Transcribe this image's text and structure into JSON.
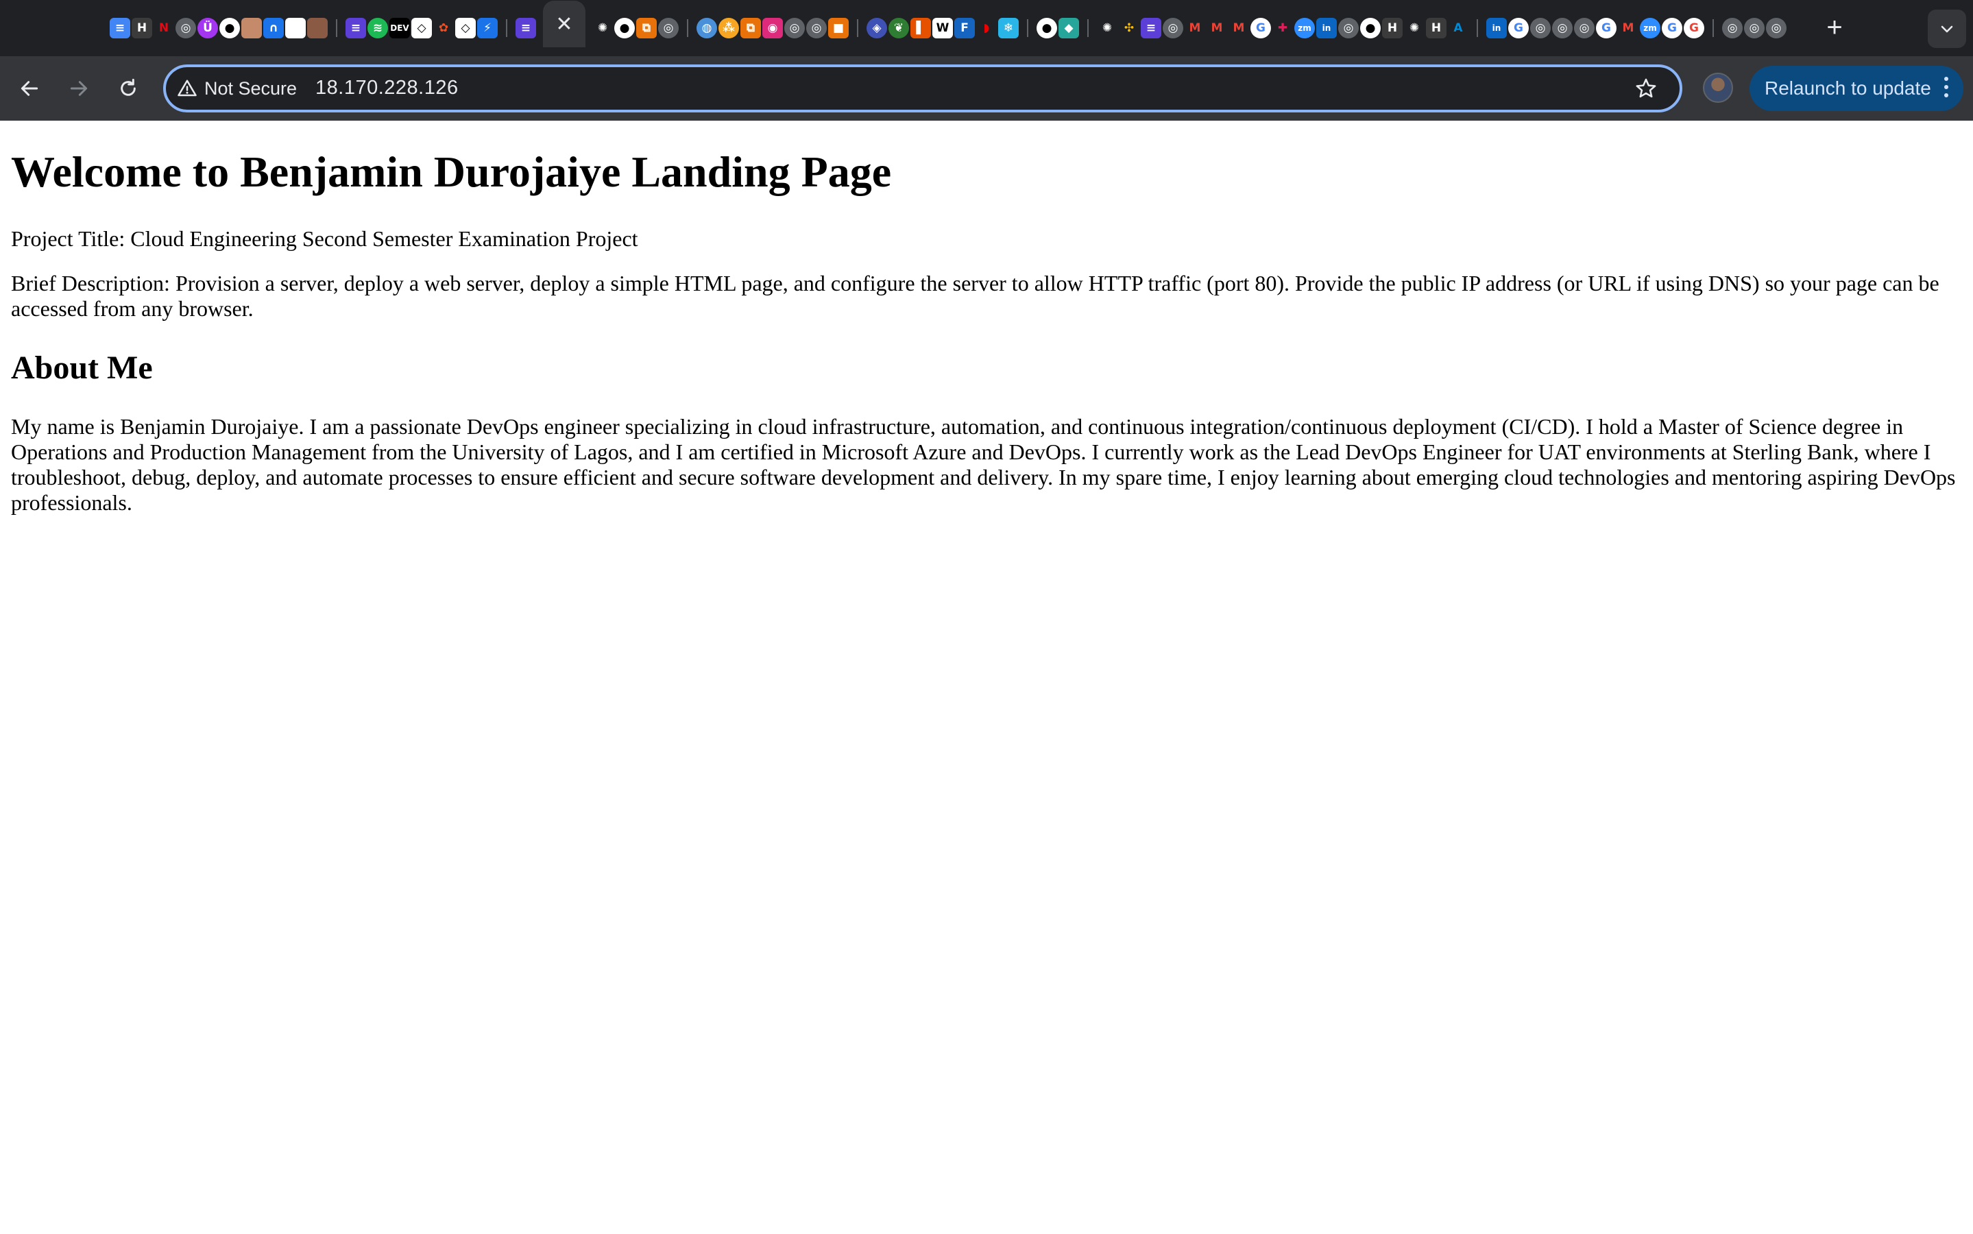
{
  "browser": {
    "tabs": {
      "active_close_glyph": "✕",
      "new_tab_glyph": "+",
      "favicons": [
        {
          "name": "google-docs-icon",
          "color": "#4285f4",
          "glyph": "≡"
        },
        {
          "name": "hashicorp-icon",
          "color": "#3b3b3b",
          "glyph": "H"
        },
        {
          "name": "netflix-icon",
          "color": "#202124",
          "glyph": "N",
          "fg": "#e50914"
        },
        {
          "name": "chatgpt-icon",
          "color": "#5f6368",
          "glyph": "◎",
          "round": true
        },
        {
          "name": "udemy-icon",
          "color": "#a435f0",
          "glyph": "Ü",
          "round": true
        },
        {
          "name": "github-icon",
          "color": "#ffffff",
          "glyph": "●",
          "fg": "#000",
          "round": true
        },
        {
          "name": "profile-photo-icon",
          "color": "#c58a6a",
          "glyph": ""
        },
        {
          "name": "ubiquiti-icon",
          "color": "#1a73e8",
          "glyph": "∩"
        },
        {
          "name": "blank-page-icon",
          "color": "#ffffff",
          "glyph": "",
          "fg": "#000"
        },
        {
          "name": "person-photo-icon",
          "color": "#8a5a44",
          "glyph": ""
        },
        {
          "sep": true
        },
        {
          "name": "tasks-icon",
          "color": "#5b3fd6",
          "glyph": "≡"
        },
        {
          "name": "spotify-icon",
          "color": "#1db954",
          "glyph": "≋",
          "round": true
        },
        {
          "name": "dev-to-icon",
          "color": "#000000",
          "glyph": "DEV"
        },
        {
          "name": "codepen-icon",
          "color": "#ffffff",
          "glyph": "◇",
          "fg": "#000"
        },
        {
          "name": "figma-icon",
          "color": "#202124",
          "glyph": "✿",
          "fg": "#f24e1e"
        },
        {
          "name": "codepen-alt-icon",
          "color": "#ffffff",
          "glyph": "◇",
          "fg": "#000"
        },
        {
          "name": "bolt-icon",
          "color": "#1a73e8",
          "glyph": "⚡"
        },
        {
          "sep": true
        },
        {
          "name": "tasks-alt-icon",
          "color": "#5b3fd6",
          "glyph": "≡"
        },
        {
          "active": true
        },
        {
          "name": "chatgpt-alt-icon",
          "color": "#202124",
          "glyph": "✺"
        },
        {
          "name": "github-alt-icon",
          "color": "#ffffff",
          "glyph": "●",
          "fg": "#000",
          "round": true
        },
        {
          "name": "copy-icon",
          "color": "#e8710a",
          "glyph": "⧉"
        },
        {
          "name": "globe-icon",
          "color": "#5f6368",
          "glyph": "◎",
          "round": true
        },
        {
          "sep": true
        },
        {
          "name": "world-icon",
          "color": "#4a90d9",
          "glyph": "◍",
          "round": true
        },
        {
          "name": "artifact-icon",
          "color": "#f6a623",
          "glyph": "⁂",
          "round": true
        },
        {
          "name": "copy-alt-icon",
          "color": "#e8710a",
          "glyph": "⧉"
        },
        {
          "name": "instagram-icon",
          "color": "#dd2a7b",
          "glyph": "◉"
        },
        {
          "name": "globe-alt-icon",
          "color": "#5f6368",
          "glyph": "◎",
          "round": true
        },
        {
          "name": "globe-third-icon",
          "color": "#5f6368",
          "glyph": "◎",
          "round": true
        },
        {
          "name": "box-icon",
          "color": "#e8710a",
          "glyph": "■"
        },
        {
          "sep": true
        },
        {
          "name": "site-icon",
          "color": "#3f51b5",
          "glyph": "◈",
          "round": true
        },
        {
          "name": "leaf-icon",
          "color": "#2e7d32",
          "glyph": "❦",
          "round": true
        },
        {
          "name": "bookmark-icon",
          "color": "#e65100",
          "glyph": "▌"
        },
        {
          "name": "wikipedia-icon",
          "color": "#ffffff",
          "glyph": "W",
          "fg": "#000"
        },
        {
          "name": "foss-linux-icon",
          "color": "#1565c0",
          "glyph": "F"
        },
        {
          "name": "redhat-icon",
          "color": "#202124",
          "glyph": "◗",
          "fg": "#ee0000"
        },
        {
          "name": "snowflake-icon",
          "color": "#29b5e8",
          "glyph": "❄"
        },
        {
          "sep": true
        },
        {
          "name": "github-third-icon",
          "color": "#ffffff",
          "glyph": "●",
          "fg": "#000",
          "round": true
        },
        {
          "name": "diamond-icon",
          "color": "#26a69a",
          "glyph": "◆"
        },
        {
          "sep": true
        },
        {
          "name": "chatgpt-third-icon",
          "color": "#202124",
          "glyph": "✺"
        },
        {
          "name": "pinwheel-icon",
          "color": "#202124",
          "glyph": "✣",
          "fg": "#fbbc04"
        },
        {
          "name": "tasks-third-icon",
          "color": "#5b3fd6",
          "glyph": "≡"
        },
        {
          "name": "globe-fourth-icon",
          "color": "#5f6368",
          "glyph": "◎",
          "round": true
        },
        {
          "name": "gmail-icon",
          "color": "#202124",
          "glyph": "M",
          "fg": "#ea4335"
        },
        {
          "name": "gmail-alt-icon",
          "color": "#202124",
          "glyph": "M",
          "fg": "#ea4335"
        },
        {
          "name": "gmail-third-icon",
          "color": "#202124",
          "glyph": "M",
          "fg": "#ea4335"
        },
        {
          "name": "google-icon",
          "color": "#ffffff",
          "glyph": "G",
          "fg": "#4285f4",
          "round": true
        },
        {
          "name": "slack-icon",
          "color": "#202124",
          "glyph": "✚",
          "fg": "#e01e5a"
        },
        {
          "name": "zoom-icon",
          "color": "#2d8cff",
          "glyph": "zm",
          "round": true
        },
        {
          "name": "linkedin-icon",
          "color": "#0a66c2",
          "glyph": "in"
        },
        {
          "name": "globe-fifth-icon",
          "color": "#5f6368",
          "glyph": "◎",
          "round": true
        },
        {
          "name": "github-fourth-icon",
          "color": "#ffffff",
          "glyph": "●",
          "fg": "#000",
          "round": true
        },
        {
          "name": "hashicorp-alt-icon",
          "color": "#3b3b3b",
          "glyph": "H"
        },
        {
          "name": "chatgpt-fourth-icon",
          "color": "#202124",
          "glyph": "✺"
        },
        {
          "name": "hashicorp-third-icon",
          "color": "#3b3b3b",
          "glyph": "H"
        },
        {
          "name": "azure-icon",
          "color": "#202124",
          "glyph": "A",
          "fg": "#0089d6"
        },
        {
          "sep": true
        },
        {
          "name": "linkedin-alt-icon",
          "color": "#0a66c2",
          "glyph": "in"
        },
        {
          "name": "google-alt-icon",
          "color": "#ffffff",
          "glyph": "G",
          "fg": "#4285f4",
          "round": true
        },
        {
          "name": "globe-sixth-icon",
          "color": "#5f6368",
          "glyph": "◎",
          "round": true
        },
        {
          "name": "globe-seventh-icon",
          "color": "#5f6368",
          "glyph": "◎",
          "round": true
        },
        {
          "name": "globe-eighth-icon",
          "color": "#5f6368",
          "glyph": "◎",
          "round": true
        },
        {
          "name": "google-third-icon",
          "color": "#ffffff",
          "glyph": "G",
          "fg": "#4285f4",
          "round": true
        },
        {
          "name": "gmail-fourth-icon",
          "color": "#202124",
          "glyph": "M",
          "fg": "#ea4335"
        },
        {
          "name": "zoom-alt-icon",
          "color": "#2d8cff",
          "glyph": "zm",
          "round": true
        },
        {
          "name": "google-fourth-icon",
          "color": "#ffffff",
          "glyph": "G",
          "fg": "#4285f4",
          "round": true
        },
        {
          "name": "google-fifth-icon",
          "color": "#ffffff",
          "glyph": "G",
          "fg": "#ea4335",
          "round": true
        },
        {
          "sep": true
        },
        {
          "name": "globe-ninth-icon",
          "color": "#5f6368",
          "glyph": "◎",
          "round": true
        },
        {
          "name": "globe-tenth-icon",
          "color": "#5f6368",
          "glyph": "◎",
          "round": true
        },
        {
          "name": "globe-eleventh-icon",
          "color": "#5f6368",
          "glyph": "◎",
          "round": true
        }
      ]
    },
    "toolbar": {
      "security_label": "Not Secure",
      "url": "18.170.228.126",
      "relaunch_label": "Relaunch to update"
    },
    "colors": {
      "accent_focus_ring": "#8ab4f8",
      "relaunch_bg": "#0b4a7e"
    }
  },
  "page": {
    "heading": "Welcome to Benjamin Durojaiye Landing Page",
    "project_title": "Project Title: Cloud Engineering Second Semester Examination Project",
    "brief_description": "Brief Description: Provision a server, deploy a web server, deploy a simple HTML page, and configure the server to allow HTTP traffic (port 80). Provide the public IP address (or URL if using DNS) so your page can be accessed from any browser.",
    "about_heading": "About Me",
    "about_text": "My name is Benjamin Durojaiye. I am a passionate DevOps engineer specializing in cloud infrastructure, automation, and continuous integration/continuous deployment (CI/CD). I hold a Master of Science degree in Operations and Production Management from the University of Lagos, and I am certified in Microsoft Azure and DevOps. I currently work as the Lead DevOps Engineer for UAT environments at Sterling Bank, where I troubleshoot, debug, deploy, and automate processes to ensure efficient and secure software development and delivery. In my spare time, I enjoy learning about emerging cloud technologies and mentoring aspiring DevOps professionals."
  }
}
